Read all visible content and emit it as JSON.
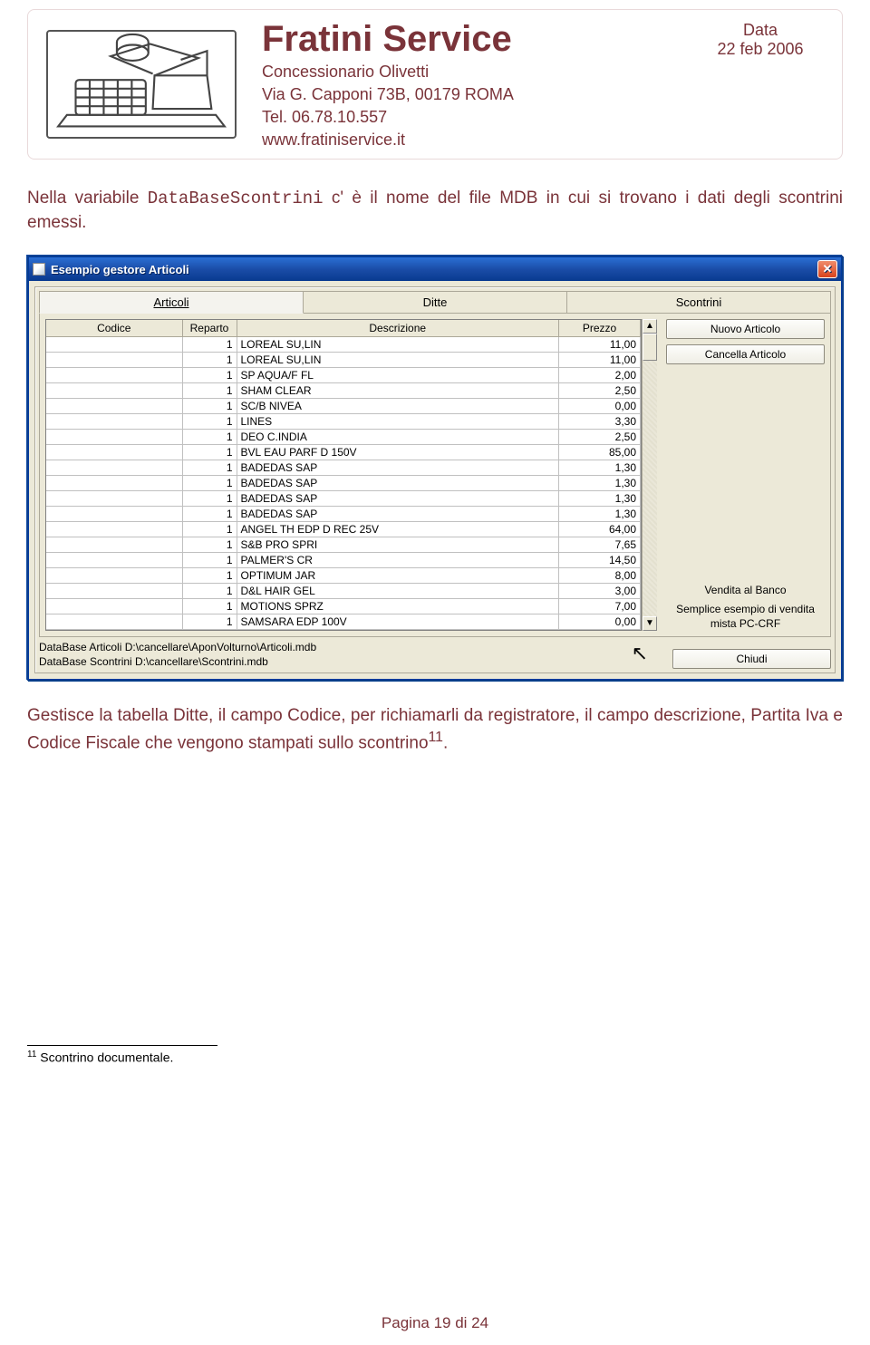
{
  "letterhead": {
    "company": "Fratini Service",
    "line1": "Concessionario Olivetti",
    "line2": "Via G. Capponi 73B, 00179 ROMA",
    "line3": "Tel. 06.78.10.557",
    "line4": "www.fratiniservice.it",
    "date_label": "Data",
    "date_value": "22 feb 2006"
  },
  "para1_a": "Nella variabile ",
  "para1_code": "DataBaseScontrini",
  "para1_b": " c' è il nome del file MDB in cui si trovano i dati degli scontrini emessi.",
  "window": {
    "title": "Esempio gestore Articoli",
    "tabs": {
      "t1": "Articoli",
      "t2": "Ditte",
      "t3": "Scontrini"
    },
    "headers": {
      "codice": "Codice",
      "reparto": "Reparto",
      "descrizione": "Descrizione",
      "prezzo": "Prezzo"
    },
    "rows": [
      {
        "reparto": "1",
        "descr": "LOREAL SU,LIN",
        "prezzo": "11,00"
      },
      {
        "reparto": "1",
        "descr": "LOREAL SU,LIN",
        "prezzo": "11,00"
      },
      {
        "reparto": "1",
        "descr": "SP AQUA/F FL",
        "prezzo": "2,00"
      },
      {
        "reparto": "1",
        "descr": "SHAM CLEAR",
        "prezzo": "2,50"
      },
      {
        "reparto": "1",
        "descr": "SC/B NIVEA",
        "prezzo": "0,00"
      },
      {
        "reparto": "1",
        "descr": "LINES",
        "prezzo": "3,30"
      },
      {
        "reparto": "1",
        "descr": "DEO C.INDIA",
        "prezzo": "2,50"
      },
      {
        "reparto": "1",
        "descr": "BVL EAU PARF D 150V",
        "prezzo": "85,00"
      },
      {
        "reparto": "1",
        "descr": "BADEDAS SAP",
        "prezzo": "1,30"
      },
      {
        "reparto": "1",
        "descr": "BADEDAS SAP",
        "prezzo": "1,30"
      },
      {
        "reparto": "1",
        "descr": "BADEDAS SAP",
        "prezzo": "1,30"
      },
      {
        "reparto": "1",
        "descr": "BADEDAS SAP",
        "prezzo": "1,30"
      },
      {
        "reparto": "1",
        "descr": "ANGEL TH EDP D REC 25V",
        "prezzo": "64,00"
      },
      {
        "reparto": "1",
        "descr": "S&B PRO SPRI",
        "prezzo": "7,65"
      },
      {
        "reparto": "1",
        "descr": "PALMER'S CR",
        "prezzo": "14,50"
      },
      {
        "reparto": "1",
        "descr": "OPTIMUM JAR",
        "prezzo": "8,00"
      },
      {
        "reparto": "1",
        "descr": "D&L HAIR GEL",
        "prezzo": "3,00"
      },
      {
        "reparto": "1",
        "descr": "MOTIONS SPRZ",
        "prezzo": "7,00"
      },
      {
        "reparto": "1",
        "descr": "SAMSARA EDP 100V",
        "prezzo": "0,00"
      }
    ],
    "btn_new": "Nuovo Articolo",
    "btn_del": "Cancella Articolo",
    "side_label1": "Vendita al Banco",
    "side_label2": "Semplice esempio di vendita mista PC-CRF",
    "status1": "DataBase Articoli D:\\cancellare\\AponVolturno\\Articoli.mdb",
    "status2": "DataBase Scontrini D:\\cancellare\\Scontrini.mdb",
    "btn_close": "Chiudi"
  },
  "para2": "Gestisce la tabella Ditte, il campo Codice, per richiamarli da registratore, il campo descrizione, Partita Iva e Codice Fiscale che vengono stampati sullo scontrino",
  "para2_sup": "11",
  "para2_end": ".",
  "footnote_num": "11",
  "footnote_text": " Scontrino documentale.",
  "page_footer": "Pagina 19 di 24"
}
